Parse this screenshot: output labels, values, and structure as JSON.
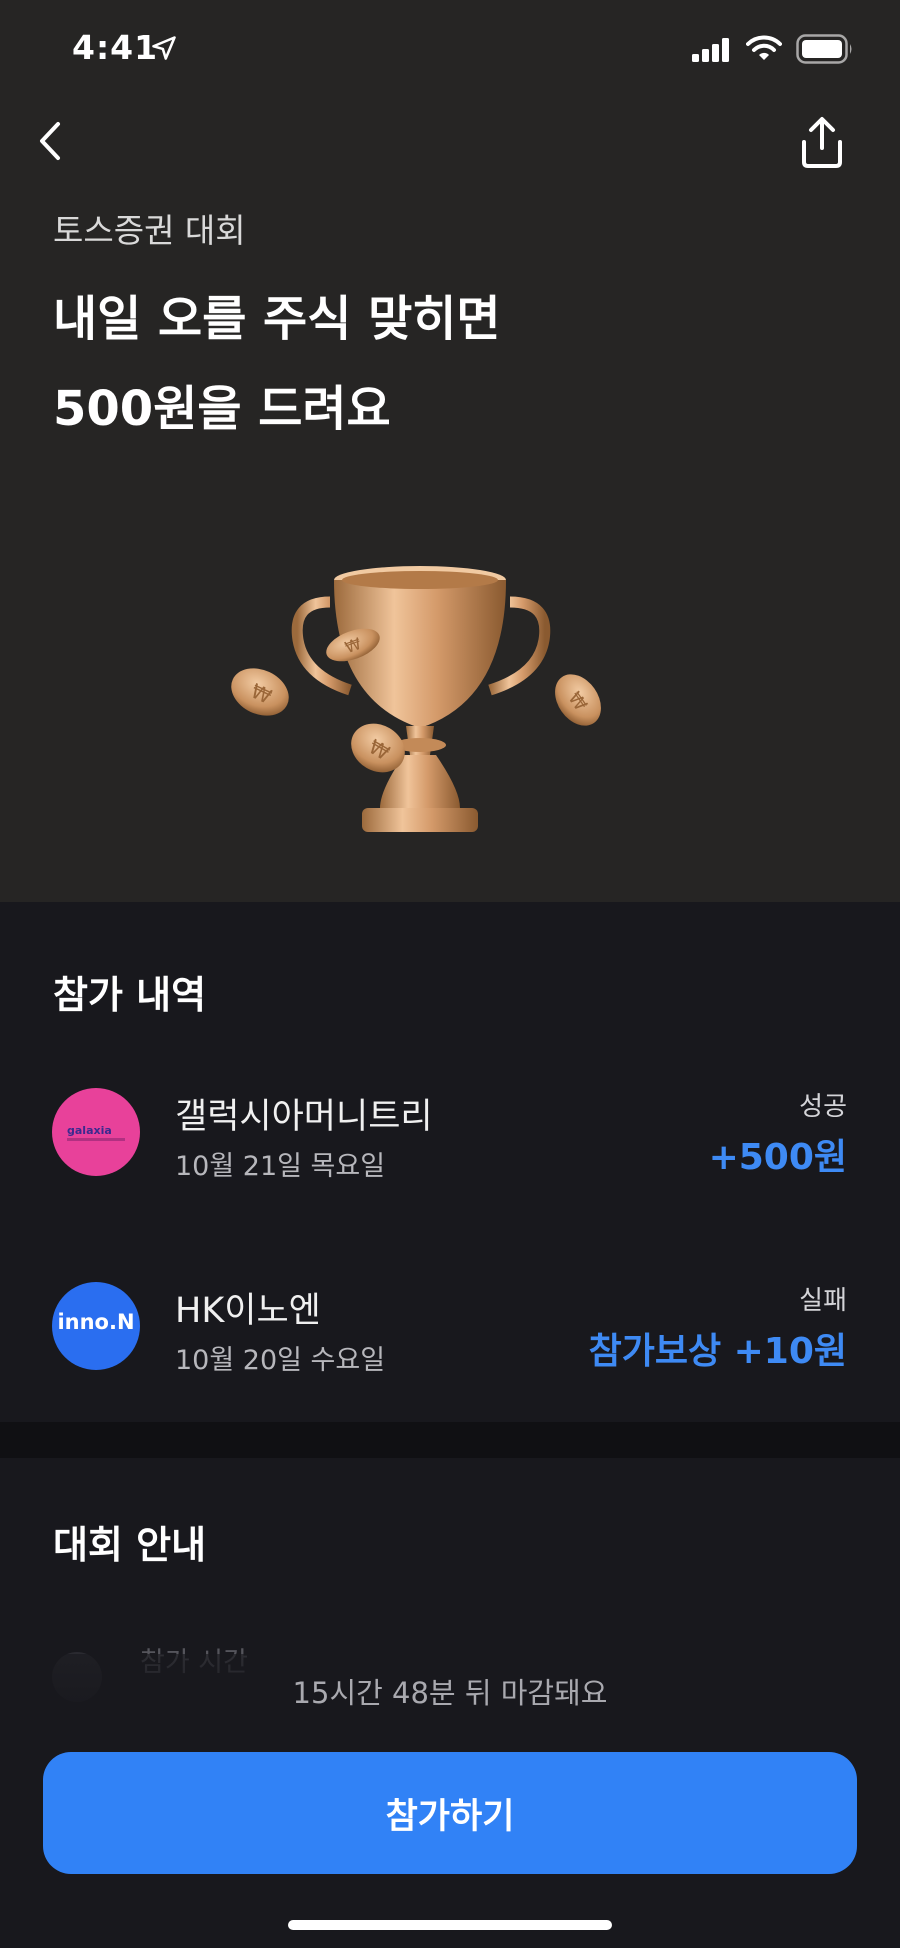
{
  "status_bar": {
    "time": "4:41",
    "icons": [
      "location-arrow-icon",
      "cellular-signal-icon",
      "wifi-icon",
      "battery-icon"
    ]
  },
  "nav": {
    "back_icon": "chevron-left-icon",
    "share_icon": "share-upload-icon"
  },
  "hero": {
    "subtitle": "토스증권 대회",
    "title_line1": "내일 오를 주식 맞히면",
    "title_line2": "500원을 드려요",
    "illustration": "trophy-with-coins"
  },
  "history": {
    "title": "참가 내역",
    "entries": [
      {
        "name": "갤럭시아머니트리",
        "date": "10월 21일 목요일",
        "result": "성공",
        "amount": "+500원",
        "logo_text": "galaxia",
        "logo_color": "#e8419a"
      },
      {
        "name": "HK이노엔",
        "date": "10월 20일 수요일",
        "result": "실패",
        "amount": "참가보상 +10원",
        "logo_text": "inno.N",
        "logo_color": "#2a6ef0"
      }
    ]
  },
  "info": {
    "title": "대회 안내",
    "first_item_label": "참가 시간"
  },
  "footer": {
    "deadline": "15시간 48분 뒤 마감돼요",
    "join_label": "참가하기"
  },
  "colors": {
    "accent": "#3182f6",
    "amount_blue": "#3e8af4",
    "hero_bg": "#262524",
    "page_bg": "#18181d"
  }
}
